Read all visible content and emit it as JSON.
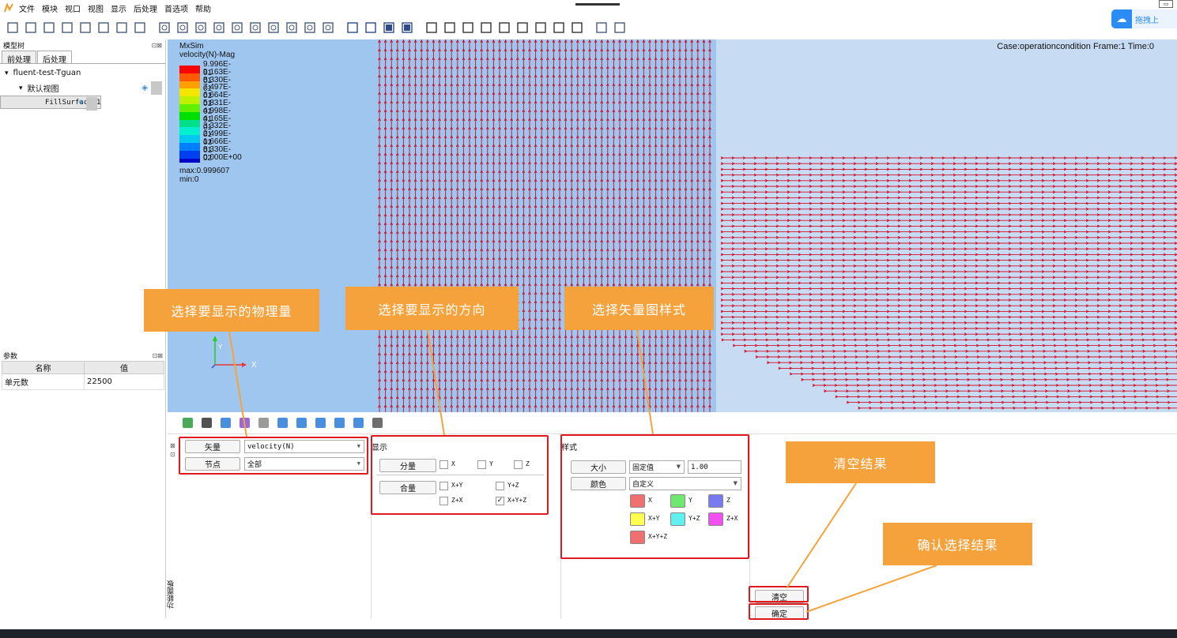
{
  "menu": {
    "items": [
      "文件",
      "模块",
      "视口",
      "视图",
      "显示",
      "后处理",
      "首选项",
      "帮助"
    ]
  },
  "toolbar": {
    "groups": [
      [
        "new-file",
        "open-file",
        "save",
        "import",
        "export",
        "tree",
        "mesh-display",
        "grid"
      ],
      [
        "zoom-add",
        "zoom-box",
        "view-fit",
        "rotate",
        "rotate-90",
        "rotate-neg90",
        "rotate-cw",
        "rotate-x",
        "zoom-in",
        "zoom-out"
      ],
      [
        "cube-wire",
        "cube-face",
        "cube-solid",
        "cube-shaded"
      ],
      [
        "view-front",
        "view-back",
        "view-top",
        "view-bottom",
        "view-left",
        "view-right",
        "axis-x",
        "axis-y",
        "axis-z"
      ],
      [
        "panel-window",
        "layers"
      ]
    ]
  },
  "baidu": {
    "label": "拖拽上"
  },
  "model_tree": {
    "title": "模型树",
    "tabs": [
      "前处理",
      "后处理"
    ],
    "active_tab": 1,
    "items": [
      {
        "label": "fluent-test-Tguan",
        "level": 0,
        "expanded": true
      },
      {
        "label": "默认视图",
        "level": 1,
        "expanded": true,
        "eye": true
      },
      {
        "label": "FillSurface-1",
        "level": 2,
        "eye": true
      }
    ]
  },
  "params": {
    "title": "参数",
    "headers": [
      "名称",
      "值"
    ],
    "rows": [
      [
        "单元数",
        "22500"
      ]
    ]
  },
  "viewport": {
    "app": "MxSim",
    "variable": "velocity(N)-Mag",
    "legend_values": [
      "9.996E-01",
      "9.163E-01",
      "8.330E-01",
      "7.497E-01",
      "6.664E-01",
      "5.831E-01",
      "4.998E-01",
      "4.165E-01",
      "3.332E-01",
      "2.499E-01",
      "1.666E-01",
      "8.330E-02",
      "0.000E+00"
    ],
    "legend_colors": [
      "#ff0000",
      "#ff5a00",
      "#ffa000",
      "#f4e600",
      "#bff000",
      "#60f000",
      "#00e000",
      "#00e08a",
      "#00f0d0",
      "#00c8f0",
      "#0080ff",
      "#0040f0",
      "#0000c8"
    ],
    "max": "max:0.999607",
    "min": "min:0",
    "case_info": "Case:operationcondition Frame:1 Time:0",
    "axis_x": "X",
    "axis_y": "Y",
    "vector_color": "#d0102a"
  },
  "annotations": {
    "quantity": "选择要显示的物理量",
    "direction": "选择要显示的方向",
    "style": "选择矢量图样式",
    "clear": "清空结果",
    "confirm": "确认选择结果"
  },
  "function_panel": {
    "side_label": "功能面板",
    "vector_label": "矢量",
    "vector_value": "velocity(N)",
    "node_label": "节点",
    "node_value": "全部",
    "display_title": "显示",
    "component_btn": "分量",
    "combined_btn": "合量",
    "components": [
      {
        "label": "X",
        "checked": false
      },
      {
        "label": "Y",
        "checked": false
      },
      {
        "label": "Z",
        "checked": false
      }
    ],
    "combined": [
      {
        "label": "X+Y",
        "checked": false
      },
      {
        "label": "Y+Z",
        "checked": false
      },
      {
        "label": "Z+X",
        "checked": false
      },
      {
        "label": "X+Y+Z",
        "checked": true
      }
    ],
    "style_title": "样式",
    "size_btn": "大小",
    "size_mode": "固定值",
    "size_value": "1.00",
    "color_btn": "颜色",
    "color_mode": "自定义",
    "swatches": [
      {
        "label": "X",
        "color": "#f07070"
      },
      {
        "label": "Y",
        "color": "#6ee86e"
      },
      {
        "label": "Z",
        "color": "#7a7af0"
      },
      {
        "label": "X+Y",
        "color": "#ffff50"
      },
      {
        "label": "Y+Z",
        "color": "#60f0f0"
      },
      {
        "label": "Z+X",
        "color": "#f050f0"
      },
      {
        "label": "X+Y+Z",
        "color": "#f07070"
      }
    ],
    "clear_btn": "清空",
    "ok_btn": "确定"
  }
}
